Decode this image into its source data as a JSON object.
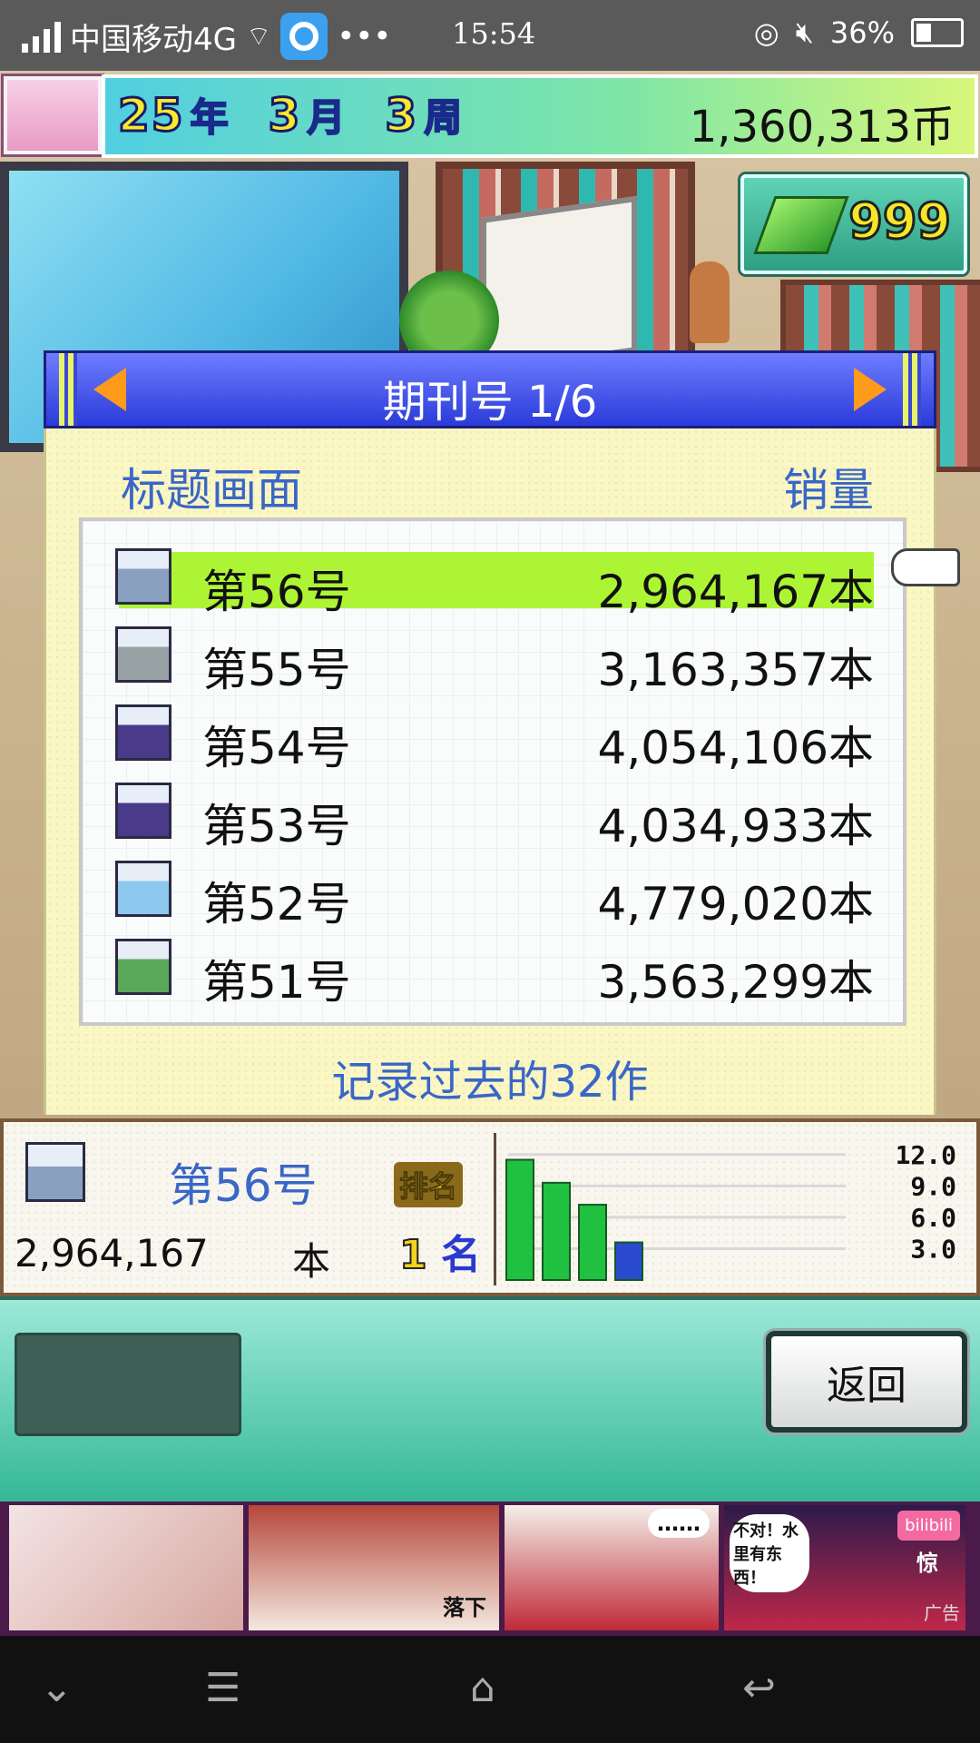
{
  "status_bar": {
    "carrier": "中国移动4G",
    "time": "15:54",
    "battery": "36%"
  },
  "hud": {
    "year_num": "25",
    "year_unit": "年",
    "month_num": "3",
    "month_unit": "月",
    "week_num": "3",
    "week_unit": "周",
    "money": "1,360,313币",
    "gem_count": "999"
  },
  "dialog": {
    "title": "期刊号 1/6",
    "col_left": "标题画面",
    "col_right": "销量",
    "footer": "记录过去的32作",
    "rows": [
      {
        "issue": "第56号",
        "sales": "2,964,167本",
        "selected": true,
        "thumb_color": "#8aa0c0"
      },
      {
        "issue": "第55号",
        "sales": "3,163,357本",
        "selected": false,
        "thumb_color": "#98a2a4"
      },
      {
        "issue": "第54号",
        "sales": "4,054,106本",
        "selected": false,
        "thumb_color": "#4a3a8a"
      },
      {
        "issue": "第53号",
        "sales": "4,034,933本",
        "selected": false,
        "thumb_color": "#4a3a8a"
      },
      {
        "issue": "第52号",
        "sales": "4,779,020本",
        "selected": false,
        "thumb_color": "#8cc8ee"
      },
      {
        "issue": "第51号",
        "sales": "3,563,299本",
        "selected": false,
        "thumb_color": "#5aa85a"
      }
    ]
  },
  "detail": {
    "issue": "第56号",
    "count": "2,964,167",
    "unit": "本",
    "rank_label": "排名",
    "rank_value": "1",
    "rank_unit": "名"
  },
  "chart_data": {
    "type": "bar",
    "categories": [
      "",
      "",
      "",
      ""
    ],
    "values": [
      11.5,
      9.3,
      7.2,
      3.6
    ],
    "colors": [
      "#20c040",
      "#20c040",
      "#20c040",
      "#2a4ad0"
    ],
    "ytick_labels": [
      "12.0",
      "9.0",
      "6.0",
      "3.0"
    ],
    "ylim": [
      0,
      12.5
    ]
  },
  "buttons": {
    "back": "返回"
  },
  "ad": {
    "caption_1": "落下",
    "caption_2": "……",
    "caption_3": "不对！水里有东西！",
    "caption_4": "惊",
    "brand": "bilibili",
    "label": "广告"
  },
  "navbar": {
    "down": "⌄",
    "menu": "☰",
    "home": "⌂",
    "back": "↩"
  }
}
